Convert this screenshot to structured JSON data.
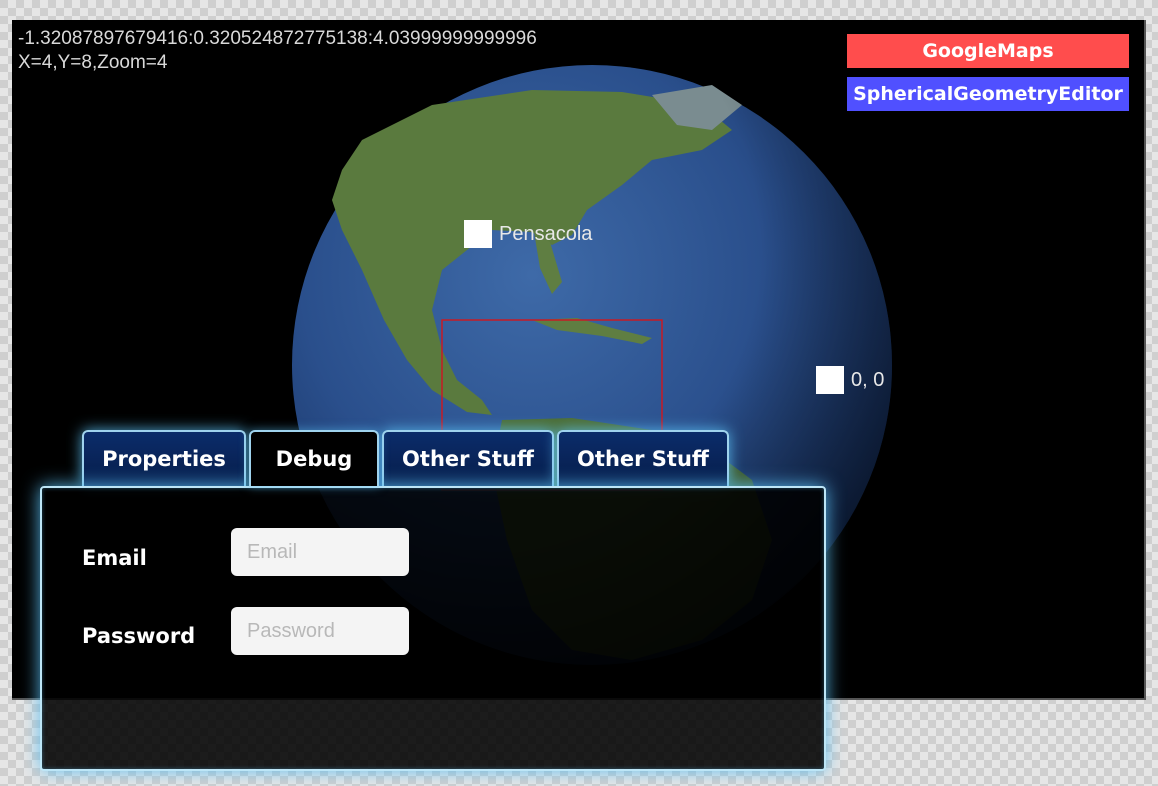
{
  "viewer": {
    "coordinate_readout": "-1.32087897679416:0.320524872775138:4.03999999999996",
    "tile_readout": "X=4,Y=8,Zoom=4"
  },
  "layers": {
    "google_maps_label": "GoogleMaps",
    "spherical_editor_label": "SphericalGeometryEditor",
    "google_maps_color": "#ff4d4d",
    "spherical_editor_color": "#5050ff"
  },
  "markers": [
    {
      "label": "Pensacola"
    },
    {
      "label": "0, 0"
    }
  ],
  "tabs": [
    {
      "label": "Properties"
    },
    {
      "label": "Debug"
    },
    {
      "label": "Other Stuff"
    },
    {
      "label": "Other Stuff"
    }
  ],
  "form": {
    "email_label": "Email",
    "email_placeholder": "Email",
    "password_label": "Password",
    "password_placeholder": "Password"
  },
  "colors": {
    "selection_box": "#c81a24",
    "panel_glow": "#5abef0",
    "tab_background": "#0b2c6a"
  }
}
